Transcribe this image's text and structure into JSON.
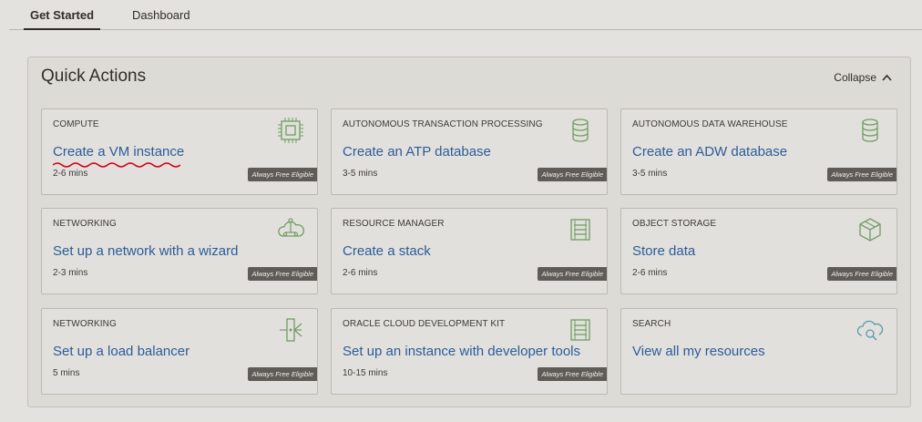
{
  "tabs": [
    {
      "label": "Get Started",
      "active": true
    },
    {
      "label": "Dashboard",
      "active": false
    }
  ],
  "panel": {
    "title": "Quick Actions",
    "collapse_label": "Collapse"
  },
  "cards": [
    {
      "category": "COMPUTE",
      "action": "Create a VM instance",
      "time": "2-6 mins",
      "badge": "Always Free Eligible",
      "icon": "chip-icon"
    },
    {
      "category": "AUTONOMOUS TRANSACTION PROCESSING",
      "action": "Create an ATP database",
      "time": "3-5 mins",
      "badge": "Always Free Eligible",
      "icon": "database-icon"
    },
    {
      "category": "AUTONOMOUS DATA WAREHOUSE",
      "action": "Create an ADW database",
      "time": "3-5 mins",
      "badge": "Always Free Eligible",
      "icon": "database-icon"
    },
    {
      "category": "NETWORKING",
      "action": "Set up a network with a wizard",
      "time": "2-3 mins",
      "badge": "Always Free Eligible",
      "icon": "cloud-network-icon"
    },
    {
      "category": "RESOURCE MANAGER",
      "action": "Create a stack",
      "time": "2-6 mins",
      "badge": "Always Free Eligible",
      "icon": "stack-icon"
    },
    {
      "category": "OBJECT STORAGE",
      "action": "Store data",
      "time": "2-6 mins",
      "badge": "Always Free Eligible",
      "icon": "box-icon"
    },
    {
      "category": "NETWORKING",
      "action": "Set up a load balancer",
      "time": "5 mins",
      "badge": "Always Free Eligible",
      "icon": "load-balancer-icon"
    },
    {
      "category": "ORACLE CLOUD DEVELOPMENT KIT",
      "action": "Set up an instance with developer tools",
      "time": "10-15 mins",
      "badge": "Always Free Eligible",
      "icon": "stack-icon"
    },
    {
      "category": "SEARCH",
      "action": "View all my resources",
      "icon": "cloud-search-icon"
    }
  ],
  "colors": {
    "link": "#2b5c9a",
    "icon_green": "#6f9e63",
    "icon_teal": "#5a9aa8",
    "badge_bg": "#5f5b56",
    "squiggle": "#d0021b"
  }
}
